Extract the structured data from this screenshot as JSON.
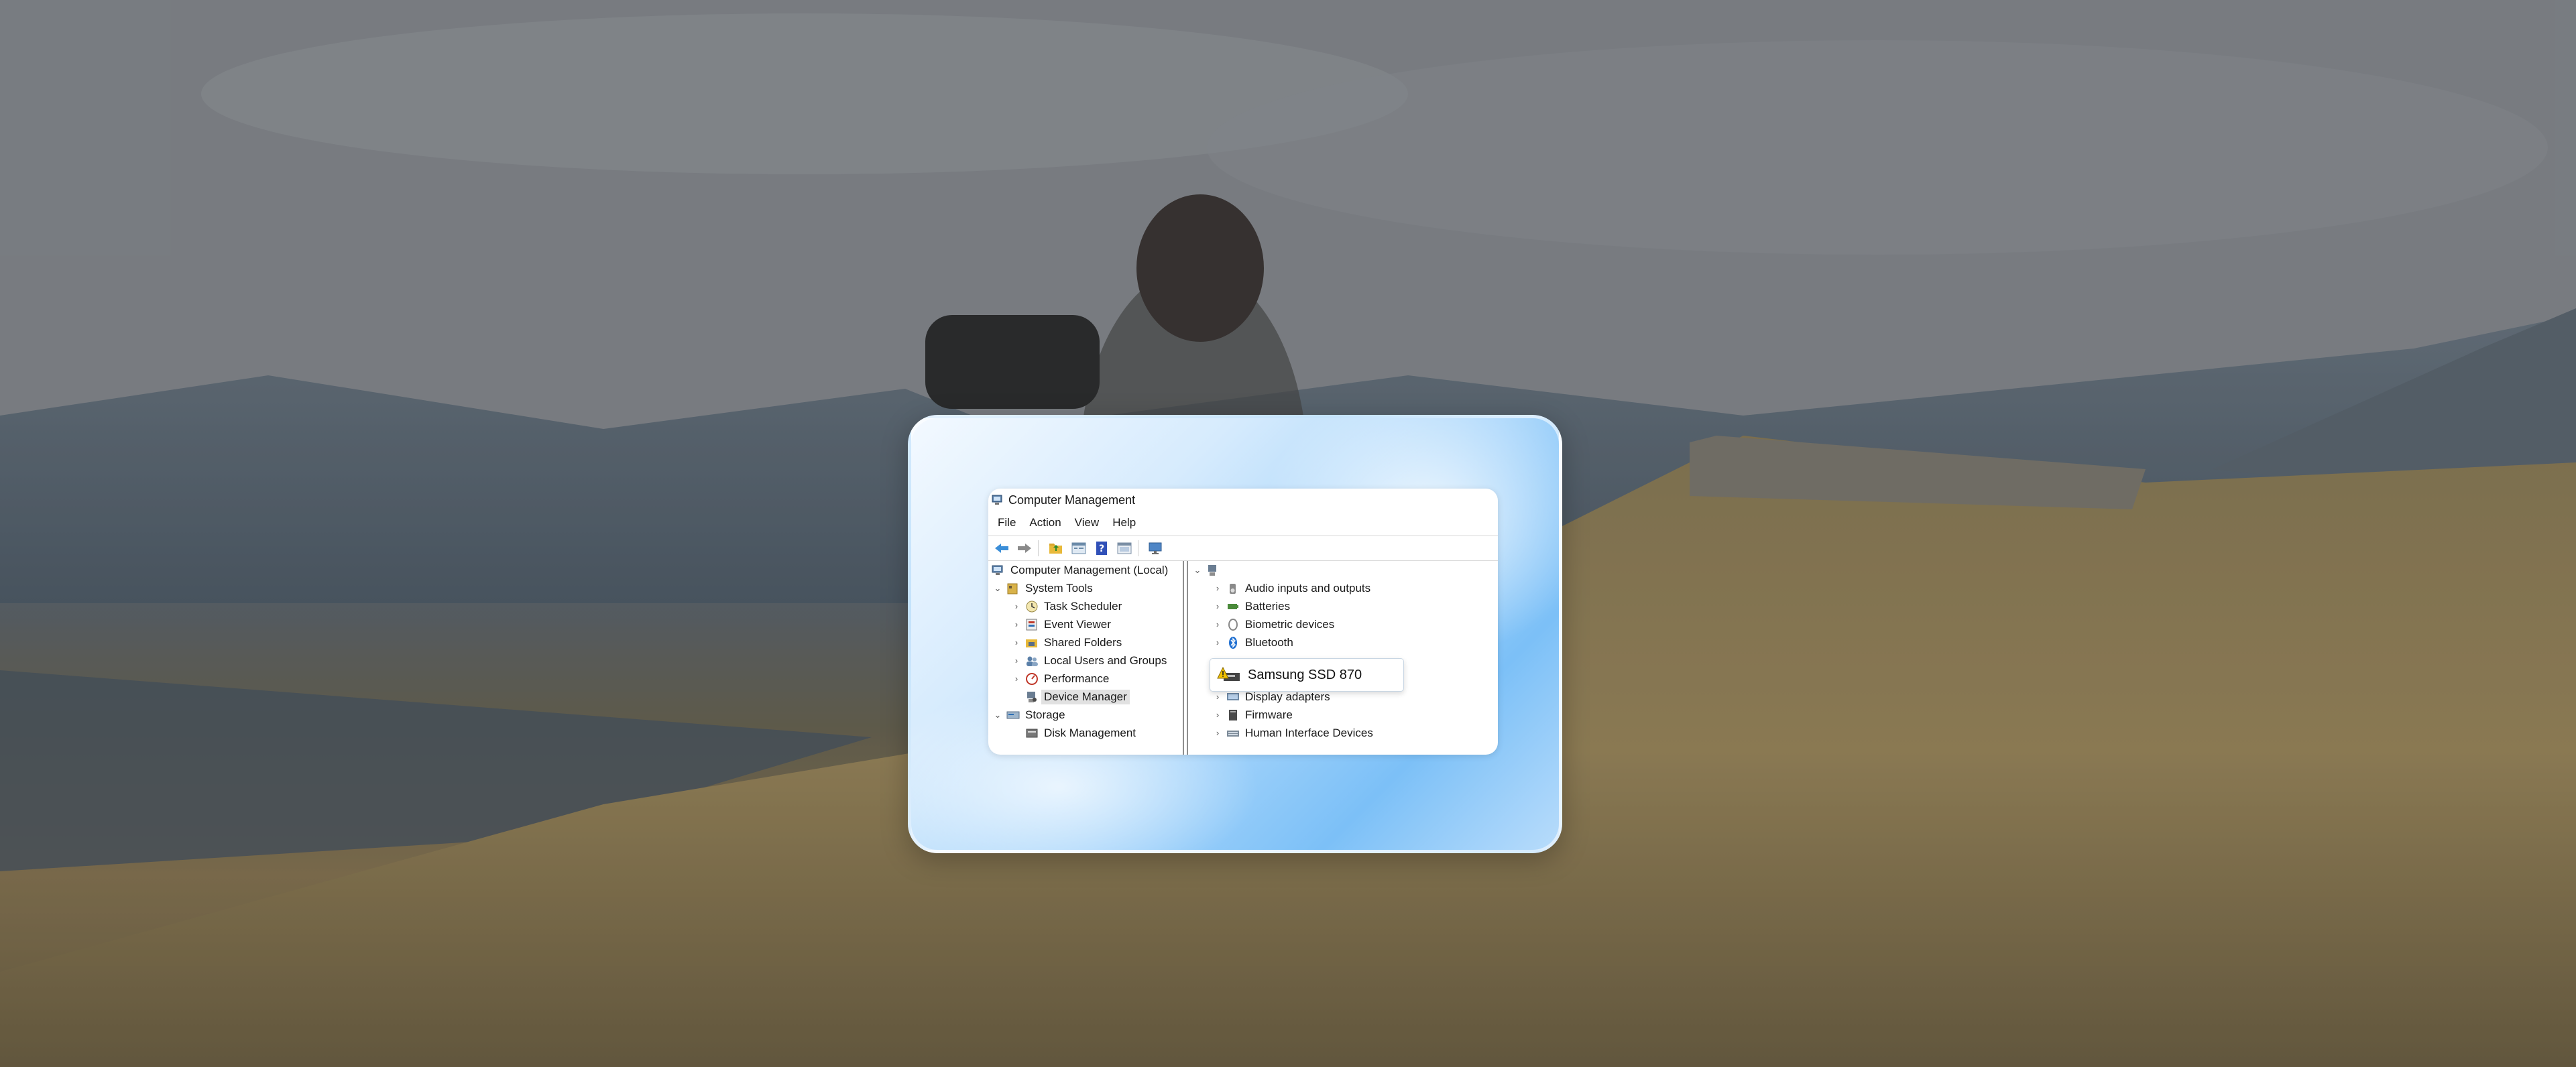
{
  "window": {
    "title": "Computer Management",
    "menu": [
      "File",
      "Action",
      "View",
      "Help"
    ]
  },
  "toolbar": {
    "buttons": [
      "back-arrow-icon",
      "forward-arrow-icon",
      "folder-up-icon",
      "properties-icon",
      "help-icon",
      "show-hide-icon",
      "monitor-icon"
    ]
  },
  "tree": {
    "root": "Computer Management (Local)",
    "system_tools": "System Tools",
    "items": [
      "Task Scheduler",
      "Event Viewer",
      "Shared Folders",
      "Local Users and Groups",
      "Performance",
      "Device Manager"
    ],
    "storage": "Storage",
    "storage_items": [
      "Disk Management"
    ],
    "selected": "Device Manager"
  },
  "devices": {
    "categories": [
      "Audio inputs and outputs",
      "Batteries",
      "Biometric devices",
      "Bluetooth",
      "Display adapters",
      "Firmware",
      "Human Interface Devices"
    ]
  },
  "tooltip": {
    "text": "Samsung SSD 870"
  },
  "colors": {
    "card_accent": "#7cc0f7",
    "selection": "#e1e1e1",
    "warning": "#f2c200"
  }
}
